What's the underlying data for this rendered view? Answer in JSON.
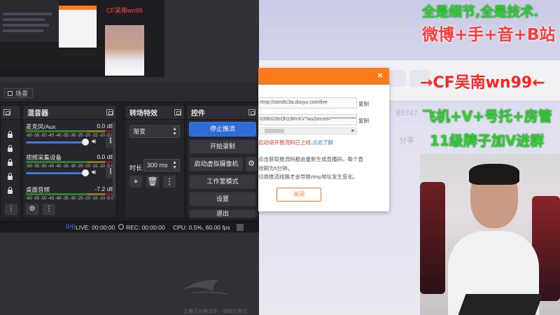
{
  "obs": {
    "scene_tab": "场景",
    "docks": {
      "mixer": "混音器",
      "transitions": "转场特效",
      "controls": "控件"
    },
    "mixer": {
      "channels": [
        {
          "name": "麦克风/Aux",
          "db": "0.0 dB"
        },
        {
          "name": "视频采集设备",
          "db": "0.0 dB"
        },
        {
          "name": "桌面音频",
          "db": "-7.2 dB"
        }
      ],
      "scale": "-60 -55 -50 -45 -40 -35 -30 -25 -20 -15 -10 -5 0"
    },
    "transitions": {
      "selected": "渐变",
      "duration_label": "时长",
      "duration_value": "300 ms"
    },
    "controls": {
      "stop_stream": "停止推流",
      "start_record": "开始录制",
      "virtual_cam": "启动虚拟摄像机",
      "studio_mode": "工作室模式",
      "settings": "设置",
      "exit": "退出"
    },
    "status": {
      "live": "LIVE: 00:00:00",
      "rec": "REC: 00:00:00",
      "cpu": "CPU: 0.5%, 60.00 fps"
    }
  },
  "dialog": {
    "server": "rtmp://sendtc3a.douyu.com/live",
    "key": "6396028rOh19RcKV?wsSecret=**************",
    "copy_label": "复制",
    "warning": "启动请开推流码已上线,",
    "warning_link": "点此了解",
    "note_1": "点击获取推流码都会重新生成直播码，每个直",
    "note_2": "效期为5分钟。",
    "note_3": "切换推流线路才会导致rtmp地址发生变化。",
    "close_button": "关闭"
  },
  "preview": {
    "label": "CF吴南wn99"
  },
  "promo": {
    "line1": "全是细节,全是技术.",
    "line2": "微博+手+音+B站",
    "line3": "→CF吴南wn99←",
    "line4": "飞机+V+号托+房管",
    "line5": "11级牌子加V进群"
  },
  "background": {
    "ghost_1": "85747",
    "ghost_2": "分享"
  },
  "bottom_note": "主播正在推流中，请稍后重试",
  "colors": {
    "obs_primary": "#2d6bd6",
    "douyu_orange": "#ff7a18",
    "promo_green": "#2fcf31",
    "promo_red": "#ff3b3b"
  }
}
